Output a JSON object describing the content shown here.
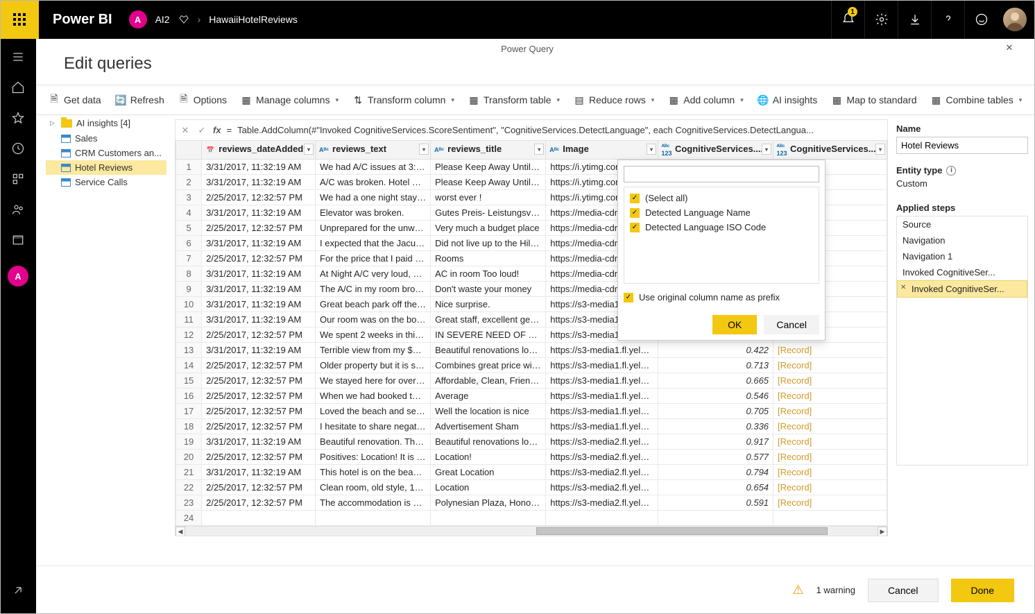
{
  "app": {
    "brand": "Power BI",
    "userInitial": "A",
    "workspace": "AI2",
    "report": "HawaiiHotelReviews",
    "notifCount": "1"
  },
  "pq": {
    "barTitle": "Power Query",
    "pageTitle": "Edit queries"
  },
  "ribbon": {
    "getData": "Get data",
    "refresh": "Refresh",
    "options": "Options",
    "manageCols": "Manage columns",
    "transformCol": "Transform column",
    "transformTbl": "Transform table",
    "reduceRows": "Reduce rows",
    "addColumn": "Add column",
    "aiInsights": "AI insights",
    "mapStd": "Map to standard",
    "combine": "Combine tables"
  },
  "queries": {
    "folder": "AI insights  [4]",
    "items": [
      "Sales",
      "CRM Customers an...",
      "Hotel Reviews",
      "Service Calls"
    ],
    "selectedIndex": 2
  },
  "formula": "Table.AddColumn(#\"Invoked CognitiveServices.ScoreSentiment\", \"CognitiveServices.DetectLanguage\", each CognitiveServices.DetectLangua...",
  "columns": [
    "reviews_dateAdded",
    "reviews_text",
    "reviews_title",
    "Image",
    "CognitiveServices....",
    "CognitiveServices...."
  ],
  "rows": [
    {
      "n": 1,
      "date": "3/31/2017, 11:32:19 AM",
      "text": "We had A/C issues at 3:30 ...",
      "title": "Please Keep Away Until Co...",
      "img": "https://i.ytimg.com/vi/-3s...",
      "score": "",
      "rec": ""
    },
    {
      "n": 2,
      "date": "3/31/2017, 11:32:19 AM",
      "text": "A/C was broken. Hotel was...",
      "title": "Please Keep Away Until Co...",
      "img": "https://i.ytimg.com/vi/gV...",
      "score": "",
      "rec": ""
    },
    {
      "n": 3,
      "date": "2/25/2017, 12:32:57 PM",
      "text": "We had a one night stay at...",
      "title": "worst ever !",
      "img": "https://i.ytimg.com/vi/xcE...",
      "score": "",
      "rec": ""
    },
    {
      "n": 4,
      "date": "3/31/2017, 11:32:19 AM",
      "text": "Elevator was broken.",
      "title": "Gutes Preis- Leistungsverh...",
      "img": "https://media-cdn.tripadv...",
      "score": "",
      "rec": ""
    },
    {
      "n": 5,
      "date": "2/25/2017, 12:32:57 PM",
      "text": "Unprepared for the unwelc...",
      "title": "Very much a budget place",
      "img": "https://media-cdn.tripadv...",
      "score": "",
      "rec": ""
    },
    {
      "n": 6,
      "date": "3/31/2017, 11:32:19 AM",
      "text": "I expected that the Jacuzzi ...",
      "title": "Did not live up to the Hilto...",
      "img": "https://media-cdn.tripadv...",
      "score": "",
      "rec": ""
    },
    {
      "n": 7,
      "date": "2/25/2017, 12:32:57 PM",
      "text": "For the price that I paid for...",
      "title": "Rooms",
      "img": "https://media-cdn.tripadv...",
      "score": "",
      "rec": ""
    },
    {
      "n": 8,
      "date": "3/31/2017, 11:32:19 AM",
      "text": "At Night A/C very loud, als...",
      "title": "AC in room Too loud!",
      "img": "https://media-cdn.tripadv...",
      "score": "",
      "rec": ""
    },
    {
      "n": 9,
      "date": "3/31/2017, 11:32:19 AM",
      "text": "The A/C in my room broke...",
      "title": "Don't waste your money",
      "img": "https://media-cdn.tripadv...",
      "score": "",
      "rec": ""
    },
    {
      "n": 10,
      "date": "3/31/2017, 11:32:19 AM",
      "text": "Great beach park off the la...",
      "title": "Nice surprise.",
      "img": "https://s3-media1.fl.yelpc...",
      "score": "",
      "rec": ""
    },
    {
      "n": 11,
      "date": "3/31/2017, 11:32:19 AM",
      "text": "Our room was on the bott...",
      "title": "Great staff, excellent getaw...",
      "img": "https://s3-media1.fl.yelpc...",
      "score": "",
      "rec": ""
    },
    {
      "n": 12,
      "date": "2/25/2017, 12:32:57 PM",
      "text": "We spent 2 weeks in this h...",
      "title": "IN SEVERE NEED OF UPDA...",
      "img": "https://s3-media1.fl.yelpc...",
      "score": "",
      "rec": ""
    },
    {
      "n": 13,
      "date": "3/31/2017, 11:32:19 AM",
      "text": "Terrible view from my $300...",
      "title": "Beautiful renovations locat...",
      "img": "https://s3-media1.fl.yelpcd...",
      "score": "0.422",
      "rec": "[Record]"
    },
    {
      "n": 14,
      "date": "2/25/2017, 12:32:57 PM",
      "text": "Older property but it is su...",
      "title": "Combines great price with ...",
      "img": "https://s3-media1.fl.yelpcd...",
      "score": "0.713",
      "rec": "[Record]"
    },
    {
      "n": 15,
      "date": "2/25/2017, 12:32:57 PM",
      "text": "We stayed here for over a ...",
      "title": "Affordable, Clean, Friendly ...",
      "img": "https://s3-media1.fl.yelpcd...",
      "score": "0.665",
      "rec": "[Record]"
    },
    {
      "n": 16,
      "date": "2/25/2017, 12:32:57 PM",
      "text": "When we had booked this ...",
      "title": "Average",
      "img": "https://s3-media1.fl.yelpcd...",
      "score": "0.546",
      "rec": "[Record]"
    },
    {
      "n": 17,
      "date": "2/25/2017, 12:32:57 PM",
      "text": "Loved the beach and service",
      "title": "Well the location is nice",
      "img": "https://s3-media1.fl.yelpcd...",
      "score": "0.705",
      "rec": "[Record]"
    },
    {
      "n": 18,
      "date": "2/25/2017, 12:32:57 PM",
      "text": "I hesitate to share negative...",
      "title": "Advertisement Sham",
      "img": "https://s3-media1.fl.yelpcd...",
      "score": "0.336",
      "rec": "[Record]"
    },
    {
      "n": 19,
      "date": "3/31/2017, 11:32:19 AM",
      "text": "Beautiful renovation. The h...",
      "title": "Beautiful renovations locat...",
      "img": "https://s3-media2.fl.yelpcd...",
      "score": "0.917",
      "rec": "[Record]"
    },
    {
      "n": 20,
      "date": "2/25/2017, 12:32:57 PM",
      "text": "Positives: Location! It is on ...",
      "title": "Location!",
      "img": "https://s3-media2.fl.yelpcd...",
      "score": "0.577",
      "rec": "[Record]"
    },
    {
      "n": 21,
      "date": "3/31/2017, 11:32:19 AM",
      "text": "This hotel is on the beach ...",
      "title": "Great Location",
      "img": "https://s3-media2.fl.yelpcd...",
      "score": "0.794",
      "rec": "[Record]"
    },
    {
      "n": 22,
      "date": "2/25/2017, 12:32:57 PM",
      "text": "Clean room, old style, 196...",
      "title": "Location",
      "img": "https://s3-media2.fl.yelpcd...",
      "score": "0.654",
      "rec": "[Record]"
    },
    {
      "n": 23,
      "date": "2/25/2017, 12:32:57 PM",
      "text": "The accommodation is bas...",
      "title": "Polynesian Plaza, Honolulu",
      "img": "https://s3-media2.fl.yelpcd...",
      "score": "0.591",
      "rec": "[Record]"
    },
    {
      "n": 24,
      "date": "",
      "text": "",
      "title": "",
      "img": "",
      "score": "",
      "rec": ""
    }
  ],
  "popup": {
    "selectAll": "(Select all)",
    "opt1": "Detected Language Name",
    "opt2": "Detected Language ISO Code",
    "prefix": "Use original column name as prefix",
    "ok": "OK",
    "cancel": "Cancel"
  },
  "props": {
    "nameLabel": "Name",
    "nameValue": "Hotel Reviews",
    "entityLabel": "Entity type",
    "entityValue": "Custom",
    "stepsLabel": "Applied steps",
    "steps": [
      "Source",
      "Navigation",
      "Navigation 1",
      "Invoked CognitiveSer...",
      "Invoked CognitiveSer..."
    ],
    "selectedStep": 4
  },
  "footer": {
    "warning": "1 warning",
    "cancel": "Cancel",
    "done": "Done"
  }
}
